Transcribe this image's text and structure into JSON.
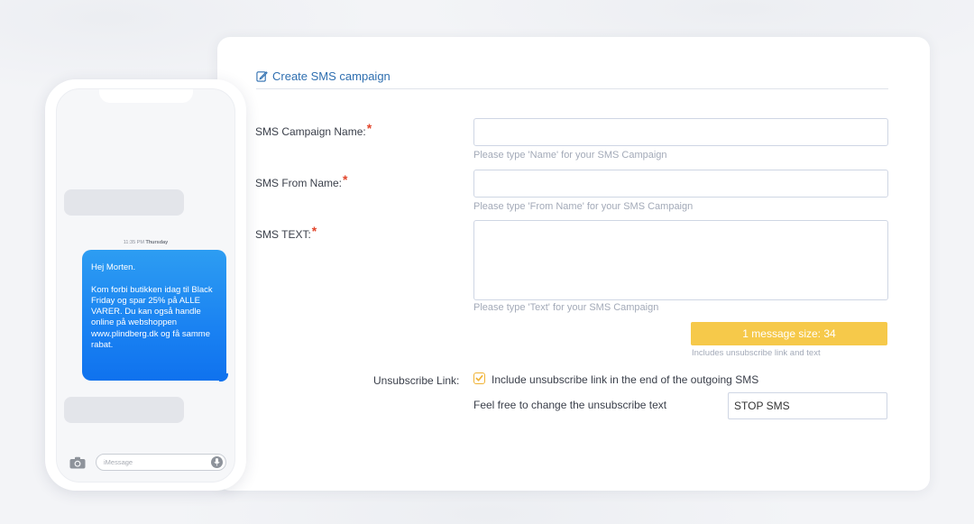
{
  "form": {
    "title": "Create SMS campaign",
    "campaign_name": {
      "label": "SMS Campaign Name:",
      "value": "",
      "help": "Please type 'Name' for your SMS Campaign"
    },
    "from_name": {
      "label": "SMS From Name:",
      "value": "",
      "help": "Please type 'From Name' for your SMS Campaign"
    },
    "sms_text": {
      "label": "SMS TEXT:",
      "value": "",
      "help": "Please type 'Text' for your SMS Campaign"
    },
    "required_marker": "*",
    "message_size": "1 message size: 34",
    "message_size_note": "Includes unsubscribe link and text",
    "unsubscribe": {
      "label": "Unsubscribe Link:",
      "checkbox_label": "Include unsubscribe link in the end of the outgoing SMS",
      "checked": true,
      "change_text": "Feel free to change the unsubscribe text",
      "stop_value": "STOP SMS"
    }
  },
  "phone": {
    "timestamp_time": "11:35 PM",
    "timestamp_day": "Thursday",
    "message": "Hej Morten.\n\nKom forbi butikken idag til Black Friday og spar 25% på ALLE VARER. Du kan også handle online på webshoppen www.plindberg.dk og få samme rabat.",
    "input_placeholder": "iMessage"
  },
  "colors": {
    "accent": "#2f6fb0",
    "required": "#e2452b",
    "size_bar": "#f6c94a",
    "bubble": "#1a82f2"
  }
}
